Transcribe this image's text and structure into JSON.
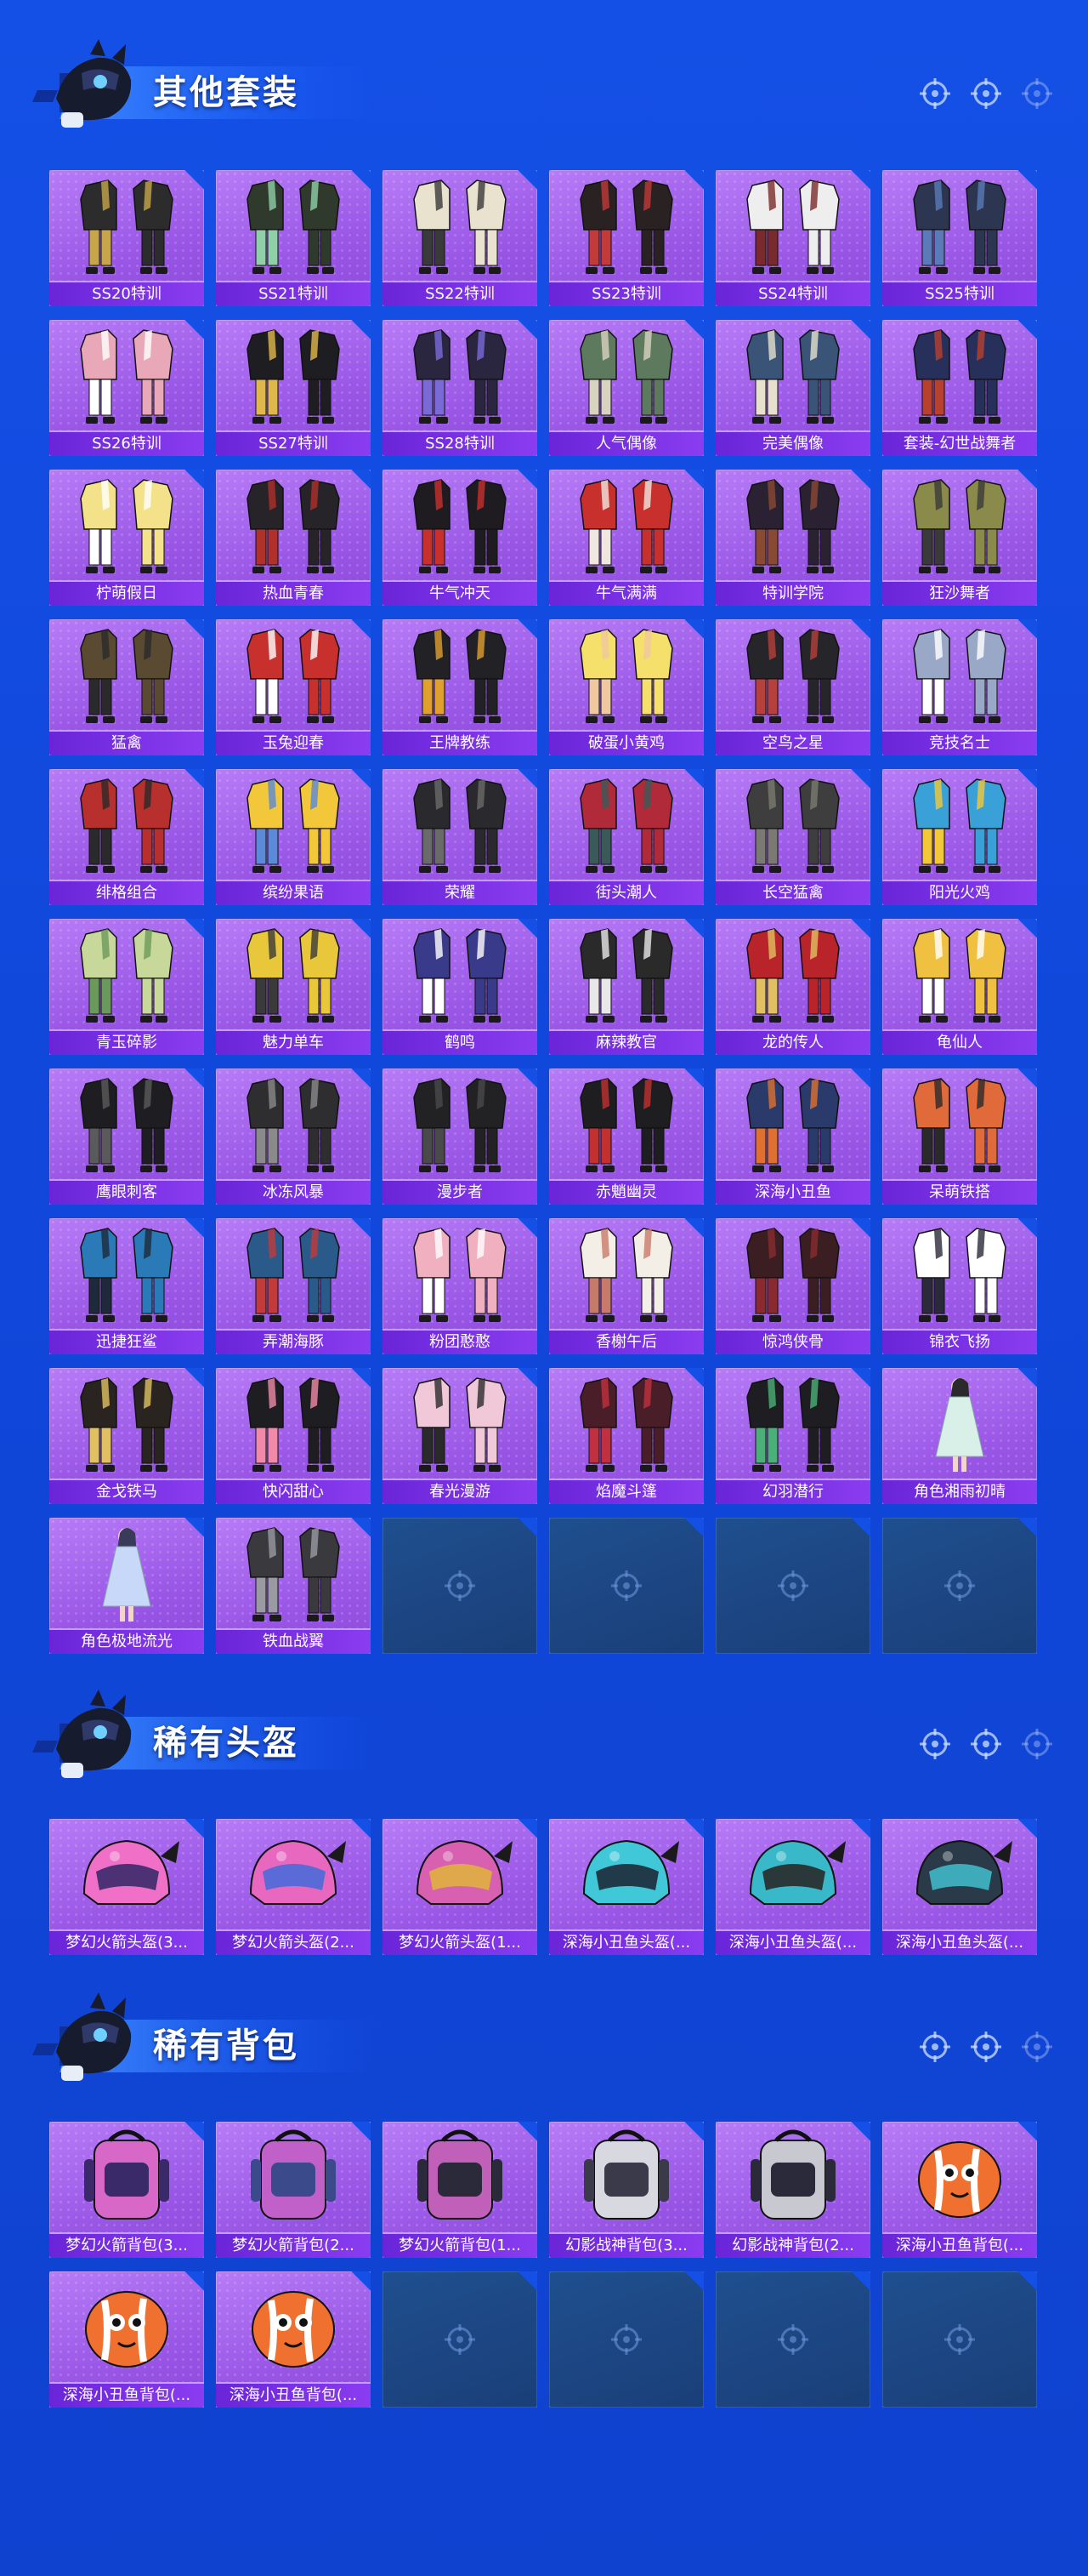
{
  "colors": {
    "background": "#1550e6",
    "card_purple": "#a86af0",
    "label_bar": "#7a30e6",
    "empty_card": "#1d4785",
    "title_text": "#ffffff"
  },
  "icons": {
    "mascot": "helmeted-mascot-icon",
    "header_decoration": "crosshair-icon",
    "empty_slot": "crosshair-icon"
  },
  "sections": [
    {
      "title": "其他套装",
      "items": [
        {
          "label": "SS20特训",
          "kind": "outfit",
          "palette": [
            "#2c2c2c",
            "#c7a64a"
          ]
        },
        {
          "label": "SS21特训",
          "kind": "outfit",
          "palette": [
            "#2f3a2c",
            "#8fd0a8"
          ]
        },
        {
          "label": "SS22特训",
          "kind": "outfit",
          "palette": [
            "#e8e2cf",
            "#3a3a3a"
          ]
        },
        {
          "label": "SS23特训",
          "kind": "outfit",
          "palette": [
            "#2a2222",
            "#c23a3a"
          ]
        },
        {
          "label": "SS24特训",
          "kind": "outfit",
          "palette": [
            "#eeeeee",
            "#7a2a2a"
          ]
        },
        {
          "label": "SS25特训",
          "kind": "outfit",
          "palette": [
            "#2c3650",
            "#5a7ab8"
          ]
        },
        {
          "label": "SS26特训",
          "kind": "outfit",
          "palette": [
            "#e9a8b8",
            "#ffffff"
          ]
        },
        {
          "label": "SS27特训",
          "kind": "outfit",
          "palette": [
            "#1e1e22",
            "#e0b84a"
          ]
        },
        {
          "label": "SS28特训",
          "kind": "outfit",
          "palette": [
            "#2a2640",
            "#7a6ad8"
          ]
        },
        {
          "label": "人气偶像",
          "kind": "outfit",
          "palette": [
            "#5e7a5e",
            "#d8d2c0"
          ]
        },
        {
          "label": "完美偶像",
          "kind": "outfit",
          "palette": [
            "#3a5478",
            "#e6e0cc"
          ]
        },
        {
          "label": "套装-幻世战舞者",
          "kind": "outfit",
          "palette": [
            "#27305a",
            "#b8402e"
          ]
        },
        {
          "label": "柠萌假日",
          "kind": "outfit",
          "palette": [
            "#f4e28a",
            "#ffffff"
          ]
        },
        {
          "label": "热血青春",
          "kind": "outfit",
          "palette": [
            "#262428",
            "#b0302a"
          ]
        },
        {
          "label": "牛气冲天",
          "kind": "outfit",
          "palette": [
            "#1e1c20",
            "#c8302e"
          ]
        },
        {
          "label": "牛气满满",
          "kind": "outfit",
          "palette": [
            "#c8302e",
            "#f0e8e0"
          ]
        },
        {
          "label": "特训学院",
          "kind": "outfit",
          "palette": [
            "#2a2232",
            "#8a4a32"
          ]
        },
        {
          "label": "狂沙舞者",
          "kind": "outfit",
          "palette": [
            "#8a8a4a",
            "#3a3a3a"
          ]
        },
        {
          "label": "猛禽",
          "kind": "outfit",
          "palette": [
            "#5a4a32",
            "#2a2a2a"
          ]
        },
        {
          "label": "玉兔迎春",
          "kind": "outfit",
          "palette": [
            "#c8302e",
            "#ffffff"
          ]
        },
        {
          "label": "王牌教练",
          "kind": "outfit",
          "palette": [
            "#222226",
            "#e0a030"
          ]
        },
        {
          "label": "破蛋小黄鸡",
          "kind": "outfit",
          "palette": [
            "#f4e06a",
            "#f0c8a0"
          ]
        },
        {
          "label": "空鸟之星",
          "kind": "outfit",
          "palette": [
            "#26262a",
            "#b8403a"
          ]
        },
        {
          "label": "竞技名士",
          "kind": "outfit",
          "palette": [
            "#9aa8c8",
            "#ffffff"
          ]
        },
        {
          "label": "绯格组合",
          "kind": "outfit",
          "palette": [
            "#b8302e",
            "#2a2a2a"
          ]
        },
        {
          "label": "缤纷果语",
          "kind": "outfit",
          "palette": [
            "#f2c83a",
            "#5a8ad8"
          ]
        },
        {
          "label": "荣耀",
          "kind": "outfit",
          "palette": [
            "#2a2a2e",
            "#6a6a6a"
          ]
        },
        {
          "label": "街头潮人",
          "kind": "outfit",
          "palette": [
            "#b02a3a",
            "#3a5a5a"
          ]
        },
        {
          "label": "长空猛禽",
          "kind": "outfit",
          "palette": [
            "#3e3e3e",
            "#7a7a72"
          ]
        },
        {
          "label": "阳光火鸡",
          "kind": "outfit",
          "palette": [
            "#3aa0d8",
            "#f2c83a"
          ]
        },
        {
          "label": "青玉碎影",
          "kind": "outfit",
          "palette": [
            "#c8d89a",
            "#6a9a5a"
          ]
        },
        {
          "label": "魅力单车",
          "kind": "outfit",
          "palette": [
            "#e8c83a",
            "#3a3a3a"
          ]
        },
        {
          "label": "鹤鸣",
          "kind": "outfit",
          "palette": [
            "#3a3a8a",
            "#ffffff"
          ]
        },
        {
          "label": "麻辣教官",
          "kind": "outfit",
          "palette": [
            "#2a2a2a",
            "#e8e8e8"
          ]
        },
        {
          "label": "龙的传人",
          "kind": "outfit",
          "palette": [
            "#b8242a",
            "#e0c060"
          ]
        },
        {
          "label": "龟仙人",
          "kind": "outfit",
          "palette": [
            "#f0c040",
            "#ffffff"
          ]
        },
        {
          "label": "鹰眼刺客",
          "kind": "outfit",
          "palette": [
            "#1e1e22",
            "#5a5a5a"
          ]
        },
        {
          "label": "冰冻风暴",
          "kind": "outfit",
          "palette": [
            "#2e2e30",
            "#8a8a8a"
          ]
        },
        {
          "label": "漫步者",
          "kind": "outfit",
          "palette": [
            "#222224",
            "#4a4a4a"
          ]
        },
        {
          "label": "赤魈幽灵",
          "kind": "outfit",
          "palette": [
            "#1e1e20",
            "#c23030"
          ]
        },
        {
          "label": "深海小丑鱼",
          "kind": "outfit",
          "palette": [
            "#2a3a6a",
            "#e07030"
          ]
        },
        {
          "label": "呆萌铁搭",
          "kind": "outfit",
          "palette": [
            "#e06a3a",
            "#2a2a2a"
          ]
        },
        {
          "label": "迅捷狂鲨",
          "kind": "outfit",
          "palette": [
            "#2a7ab8",
            "#1e2a3a"
          ]
        },
        {
          "label": "弄潮海豚",
          "kind": "outfit",
          "palette": [
            "#2a5a8a",
            "#c23a3a"
          ]
        },
        {
          "label": "粉团憨憨",
          "kind": "outfit",
          "palette": [
            "#f0b0c0",
            "#ffffff"
          ]
        },
        {
          "label": "香榭午后",
          "kind": "outfit",
          "palette": [
            "#f4efe6",
            "#c87a6a"
          ]
        },
        {
          "label": "惊鸿侠骨",
          "kind": "outfit",
          "palette": [
            "#3a1e22",
            "#8a2a2e"
          ]
        },
        {
          "label": "锦衣飞扬",
          "kind": "outfit",
          "palette": [
            "#ffffff",
            "#2a2a3a"
          ]
        },
        {
          "label": "金戈铁马",
          "kind": "outfit",
          "palette": [
            "#2a2420",
            "#e0c060"
          ]
        },
        {
          "label": "快闪甜心",
          "kind": "outfit",
          "palette": [
            "#1e1e22",
            "#f08aa8"
          ]
        },
        {
          "label": "春光漫游",
          "kind": "outfit",
          "palette": [
            "#f0c8d8",
            "#2a2a2a"
          ]
        },
        {
          "label": "焰魔斗篷",
          "kind": "outfit",
          "palette": [
            "#4a1e28",
            "#c03040"
          ]
        },
        {
          "label": "幻羽潜行",
          "kind": "outfit",
          "palette": [
            "#1e1e22",
            "#4ab078"
          ]
        },
        {
          "label": "角色湘雨初晴",
          "kind": "figure",
          "palette": [
            "#d8f0e8",
            "#2a2a2a"
          ]
        },
        {
          "label": "角色极地流光",
          "kind": "figure",
          "palette": [
            "#c8d8f8",
            "#3a3a5a"
          ]
        },
        {
          "label": "铁血战翼",
          "kind": "outfit",
          "palette": [
            "#3a3a3e",
            "#9a9aa2"
          ]
        },
        {
          "empty": true
        },
        {
          "empty": true
        },
        {
          "empty": true
        },
        {
          "empty": true
        }
      ]
    },
    {
      "title": "稀有头盔",
      "items": [
        {
          "label": "梦幻火箭头盔(3...",
          "kind": "helmet",
          "palette": [
            "#f070c8",
            "#3a2a6a"
          ]
        },
        {
          "label": "梦幻火箭头盔(2...",
          "kind": "helmet",
          "palette": [
            "#e868c0",
            "#4a6ad8"
          ]
        },
        {
          "label": "梦幻火箭头盔(1...",
          "kind": "helmet",
          "palette": [
            "#d860b0",
            "#e0b040"
          ]
        },
        {
          "label": "深海小丑鱼头盔(...",
          "kind": "helmet",
          "palette": [
            "#40c8d8",
            "#1e2a3a"
          ]
        },
        {
          "label": "深海小丑鱼头盔(...",
          "kind": "helmet",
          "palette": [
            "#38b8c8",
            "#2a2a2a"
          ]
        },
        {
          "label": "深海小丑鱼头盔(...",
          "kind": "helmet",
          "palette": [
            "#2a3a48",
            "#40b8c8"
          ]
        }
      ]
    },
    {
      "title": "稀有背包",
      "items": [
        {
          "label": "梦幻火箭背包(3...",
          "kind": "backpack",
          "palette": [
            "#d868c8",
            "#3a2a6a"
          ]
        },
        {
          "label": "梦幻火箭背包(2...",
          "kind": "backpack",
          "palette": [
            "#c060c8",
            "#3a4a8a"
          ]
        },
        {
          "label": "梦幻火箭背包(1...",
          "kind": "backpack",
          "palette": [
            "#c060b8",
            "#2a2a3a"
          ]
        },
        {
          "label": "幻影战神背包(3...",
          "kind": "backpack",
          "palette": [
            "#d8d8e0",
            "#3a3a4a"
          ]
        },
        {
          "label": "幻影战神背包(2...",
          "kind": "backpack",
          "palette": [
            "#c8c8d0",
            "#2a2a3a"
          ]
        },
        {
          "label": "深海小丑鱼背包(...",
          "kind": "fish",
          "palette": [
            "#f07030",
            "#ffffff"
          ]
        },
        {
          "label": "深海小丑鱼背包(...",
          "kind": "fish",
          "palette": [
            "#f07030",
            "#ffffff"
          ]
        },
        {
          "label": "深海小丑鱼背包(...",
          "kind": "fish",
          "palette": [
            "#f07030",
            "#ffffff"
          ]
        },
        {
          "empty": true
        },
        {
          "empty": true
        },
        {
          "empty": true
        },
        {
          "empty": true
        }
      ]
    }
  ]
}
